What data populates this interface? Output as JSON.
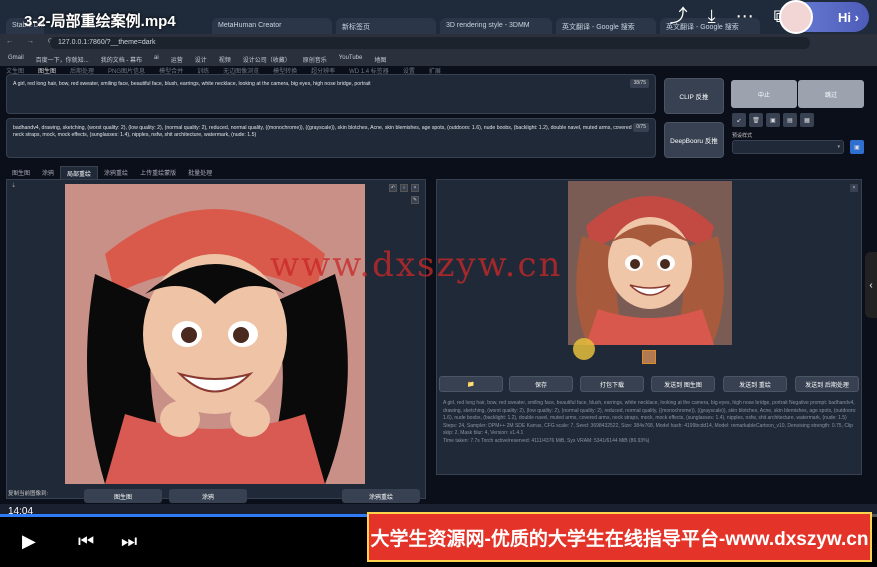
{
  "video": {
    "title": "3-2-局部重绘案例.mp4",
    "time": "14:04",
    "progress_fraction": 0.42
  },
  "header_icons": [
    "share-icon",
    "download-icon",
    "more-icon",
    "screen-icon",
    "crop-icon"
  ],
  "hi_label": "Hi",
  "browser": {
    "tabs": [
      "Stable Diffusion",
      "MetaHuman Creator",
      "新标签页",
      "3D rendering style - 3DMM",
      "英文翻译 - Google 搜索",
      "英文翻译 - Google 搜索"
    ],
    "url": "127.0.0.1:7860/?__theme=dark",
    "bookmarks": [
      "Gmail",
      "百度一下，你就知...",
      "我的文档 - 幕布",
      "ai",
      "运营",
      "设计",
      "视频",
      "设计公司（收藏）",
      "原创音乐",
      "YouTube",
      "地图"
    ]
  },
  "app": {
    "top_tabs": [
      "文生图",
      "图生图",
      "后期处理",
      "PNG图片信息",
      "模型合并",
      "训练",
      "无边图像浏览",
      "模型转换",
      "超分辨率",
      "WD 1.4 标签器",
      "设置",
      "扩展"
    ],
    "positive_prompt": "A girl, red long hair, bow, red sweater, smiling face, beautiful face, blush, earrings, white necklace, looking at the camera, big eyes, high nose bridge, portrait",
    "positive_count": "38/75",
    "negative_prompt": "badhandv4, drawing, sketching, (worst quality: 2), (low quality: 2), (normal quality: 2), reduced, normal quality, ((monochrome)), ((grayscale)), skin blotches, Acne, skin blemishes, age spots, (outdoors: 1.6), nude boobs, (backlight: 1.2), double navel, muted arms, covered arms, neck straps, mock, mock effects, (sunglasses: 1.4), nipples, nsfw, shit architecture, watermark, (nude: 1.5)",
    "negative_count": "0/75",
    "clip_button": "CLIP 反推",
    "deepbooru_button": "DeepBooru 反推",
    "interrupt_button": "中止",
    "skip_button": "跳过",
    "style_label": "预设样式",
    "subtabs": [
      "图生图",
      "涂鸦",
      "局部重绘",
      "涂鸦重绘",
      "上传重绘蒙版",
      "批量处理"
    ],
    "active_subtab": "局部重绘",
    "action_buttons": [
      "📁",
      "保存",
      "打包下载",
      "发送到 图生图",
      "发送到 重绘",
      "发送到 后期处理"
    ],
    "info_text": "A girl, red long hair, bow, red sweater, smiling face, beautiful face, blush, earrings, white necklace, looking at the camera, big eyes, high nose bridge, portrait Negative prompt: badhandv4, drawing, sketching, (worst quality: 2), (low quality: 2), (normal quality: 2), reduced, normal quality, ((monochrome)), ((grayscale)), skin blotches, Acne, skin blemishes, age spots, (outdoors: 1.6), nude boobs, (backlight: 1.2), double navel, muted arms, covered arms, neck straps, mock, mock effects, (sunglasses: 1.4), nipples, nsfw, shit architecture, watermark, (nude: 1.5) Steps: 24, Sampler: DPM++ 2M SDE Karras, CFG scale: 7, Seed: 3698432522, Size: 384x768, Model hash: 4199bcdd14, Model: remarkableCartoon_v10, Denoising strength: 0.75, Clip skip: 2, Mask blur: 4, Version: v1.4.1",
    "time_text": "Time taken: 7.7s  Torch active/reserved: 4111/4376 MiB, Sys VRAM: 5341/6144 MiB (86.93%)",
    "bottom_left_label": "复制当前图像到:",
    "bottom_buttons": [
      "图生图",
      "涂鸦",
      "涂鸦重绘"
    ]
  },
  "watermark": "www.dxszyw.cn",
  "banner": "大学生资源网-优质的大学生在线指导平台-www.dxszyw.cn"
}
